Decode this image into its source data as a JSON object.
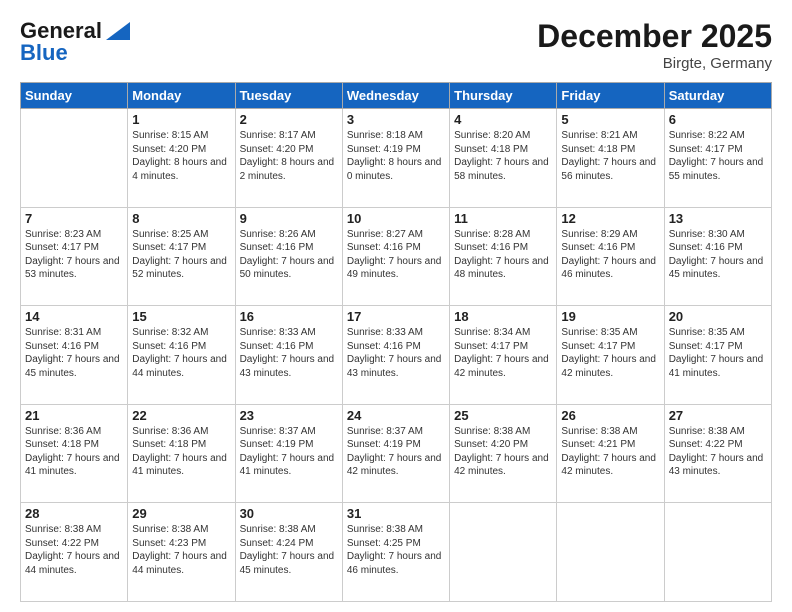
{
  "header": {
    "logo_line1": "General",
    "logo_line2": "Blue",
    "title": "December 2025",
    "location": "Birgte, Germany"
  },
  "weekdays": [
    "Sunday",
    "Monday",
    "Tuesday",
    "Wednesday",
    "Thursday",
    "Friday",
    "Saturday"
  ],
  "weeks": [
    [
      {
        "day": "",
        "sunrise": "",
        "sunset": "",
        "daylight": ""
      },
      {
        "day": "1",
        "sunrise": "Sunrise: 8:15 AM",
        "sunset": "Sunset: 4:20 PM",
        "daylight": "Daylight: 8 hours and 4 minutes."
      },
      {
        "day": "2",
        "sunrise": "Sunrise: 8:17 AM",
        "sunset": "Sunset: 4:20 PM",
        "daylight": "Daylight: 8 hours and 2 minutes."
      },
      {
        "day": "3",
        "sunrise": "Sunrise: 8:18 AM",
        "sunset": "Sunset: 4:19 PM",
        "daylight": "Daylight: 8 hours and 0 minutes."
      },
      {
        "day": "4",
        "sunrise": "Sunrise: 8:20 AM",
        "sunset": "Sunset: 4:18 PM",
        "daylight": "Daylight: 7 hours and 58 minutes."
      },
      {
        "day": "5",
        "sunrise": "Sunrise: 8:21 AM",
        "sunset": "Sunset: 4:18 PM",
        "daylight": "Daylight: 7 hours and 56 minutes."
      },
      {
        "day": "6",
        "sunrise": "Sunrise: 8:22 AM",
        "sunset": "Sunset: 4:17 PM",
        "daylight": "Daylight: 7 hours and 55 minutes."
      }
    ],
    [
      {
        "day": "7",
        "sunrise": "Sunrise: 8:23 AM",
        "sunset": "Sunset: 4:17 PM",
        "daylight": "Daylight: 7 hours and 53 minutes."
      },
      {
        "day": "8",
        "sunrise": "Sunrise: 8:25 AM",
        "sunset": "Sunset: 4:17 PM",
        "daylight": "Daylight: 7 hours and 52 minutes."
      },
      {
        "day": "9",
        "sunrise": "Sunrise: 8:26 AM",
        "sunset": "Sunset: 4:16 PM",
        "daylight": "Daylight: 7 hours and 50 minutes."
      },
      {
        "day": "10",
        "sunrise": "Sunrise: 8:27 AM",
        "sunset": "Sunset: 4:16 PM",
        "daylight": "Daylight: 7 hours and 49 minutes."
      },
      {
        "day": "11",
        "sunrise": "Sunrise: 8:28 AM",
        "sunset": "Sunset: 4:16 PM",
        "daylight": "Daylight: 7 hours and 48 minutes."
      },
      {
        "day": "12",
        "sunrise": "Sunrise: 8:29 AM",
        "sunset": "Sunset: 4:16 PM",
        "daylight": "Daylight: 7 hours and 46 minutes."
      },
      {
        "day": "13",
        "sunrise": "Sunrise: 8:30 AM",
        "sunset": "Sunset: 4:16 PM",
        "daylight": "Daylight: 7 hours and 45 minutes."
      }
    ],
    [
      {
        "day": "14",
        "sunrise": "Sunrise: 8:31 AM",
        "sunset": "Sunset: 4:16 PM",
        "daylight": "Daylight: 7 hours and 45 minutes."
      },
      {
        "day": "15",
        "sunrise": "Sunrise: 8:32 AM",
        "sunset": "Sunset: 4:16 PM",
        "daylight": "Daylight: 7 hours and 44 minutes."
      },
      {
        "day": "16",
        "sunrise": "Sunrise: 8:33 AM",
        "sunset": "Sunset: 4:16 PM",
        "daylight": "Daylight: 7 hours and 43 minutes."
      },
      {
        "day": "17",
        "sunrise": "Sunrise: 8:33 AM",
        "sunset": "Sunset: 4:16 PM",
        "daylight": "Daylight: 7 hours and 43 minutes."
      },
      {
        "day": "18",
        "sunrise": "Sunrise: 8:34 AM",
        "sunset": "Sunset: 4:17 PM",
        "daylight": "Daylight: 7 hours and 42 minutes."
      },
      {
        "day": "19",
        "sunrise": "Sunrise: 8:35 AM",
        "sunset": "Sunset: 4:17 PM",
        "daylight": "Daylight: 7 hours and 42 minutes."
      },
      {
        "day": "20",
        "sunrise": "Sunrise: 8:35 AM",
        "sunset": "Sunset: 4:17 PM",
        "daylight": "Daylight: 7 hours and 41 minutes."
      }
    ],
    [
      {
        "day": "21",
        "sunrise": "Sunrise: 8:36 AM",
        "sunset": "Sunset: 4:18 PM",
        "daylight": "Daylight: 7 hours and 41 minutes."
      },
      {
        "day": "22",
        "sunrise": "Sunrise: 8:36 AM",
        "sunset": "Sunset: 4:18 PM",
        "daylight": "Daylight: 7 hours and 41 minutes."
      },
      {
        "day": "23",
        "sunrise": "Sunrise: 8:37 AM",
        "sunset": "Sunset: 4:19 PM",
        "daylight": "Daylight: 7 hours and 41 minutes."
      },
      {
        "day": "24",
        "sunrise": "Sunrise: 8:37 AM",
        "sunset": "Sunset: 4:19 PM",
        "daylight": "Daylight: 7 hours and 42 minutes."
      },
      {
        "day": "25",
        "sunrise": "Sunrise: 8:38 AM",
        "sunset": "Sunset: 4:20 PM",
        "daylight": "Daylight: 7 hours and 42 minutes."
      },
      {
        "day": "26",
        "sunrise": "Sunrise: 8:38 AM",
        "sunset": "Sunset: 4:21 PM",
        "daylight": "Daylight: 7 hours and 42 minutes."
      },
      {
        "day": "27",
        "sunrise": "Sunrise: 8:38 AM",
        "sunset": "Sunset: 4:22 PM",
        "daylight": "Daylight: 7 hours and 43 minutes."
      }
    ],
    [
      {
        "day": "28",
        "sunrise": "Sunrise: 8:38 AM",
        "sunset": "Sunset: 4:22 PM",
        "daylight": "Daylight: 7 hours and 44 minutes."
      },
      {
        "day": "29",
        "sunrise": "Sunrise: 8:38 AM",
        "sunset": "Sunset: 4:23 PM",
        "daylight": "Daylight: 7 hours and 44 minutes."
      },
      {
        "day": "30",
        "sunrise": "Sunrise: 8:38 AM",
        "sunset": "Sunset: 4:24 PM",
        "daylight": "Daylight: 7 hours and 45 minutes."
      },
      {
        "day": "31",
        "sunrise": "Sunrise: 8:38 AM",
        "sunset": "Sunset: 4:25 PM",
        "daylight": "Daylight: 7 hours and 46 minutes."
      },
      {
        "day": "",
        "sunrise": "",
        "sunset": "",
        "daylight": ""
      },
      {
        "day": "",
        "sunrise": "",
        "sunset": "",
        "daylight": ""
      },
      {
        "day": "",
        "sunrise": "",
        "sunset": "",
        "daylight": ""
      }
    ]
  ]
}
